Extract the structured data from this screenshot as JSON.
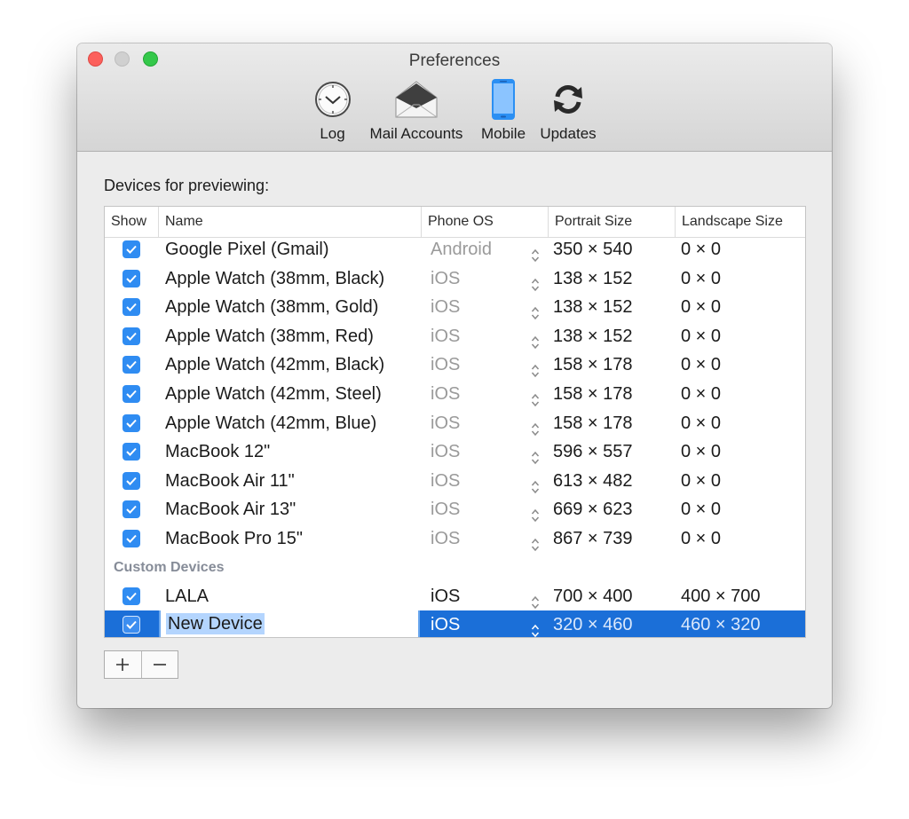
{
  "window": {
    "title": "Preferences"
  },
  "toolbar": [
    {
      "id": "log",
      "label": "Log",
      "icon": "clock-icon"
    },
    {
      "id": "mail",
      "label": "Mail Accounts",
      "icon": "envelope-icon"
    },
    {
      "id": "mobile",
      "label": "Mobile",
      "icon": "phone-icon",
      "selected": true
    },
    {
      "id": "updates",
      "label": "Updates",
      "icon": "refresh-icon"
    }
  ],
  "section_label": "Devices for previewing:",
  "columns": {
    "show": "Show",
    "name": "Name",
    "os": "Phone OS",
    "portrait": "Portrait Size",
    "landscape": "Landscape Size"
  },
  "devices": [
    {
      "checked": true,
      "name": "Google Pixel (Gmail)",
      "os": "Android",
      "portrait": "350 × 540",
      "landscape": "0 × 0"
    },
    {
      "checked": true,
      "name": "Apple Watch (38mm, Black)",
      "os": "iOS",
      "portrait": "138 × 152",
      "landscape": "0 × 0"
    },
    {
      "checked": true,
      "name": "Apple Watch (38mm, Gold)",
      "os": "iOS",
      "portrait": "138 × 152",
      "landscape": "0 × 0"
    },
    {
      "checked": true,
      "name": "Apple Watch (38mm, Red)",
      "os": "iOS",
      "portrait": "138 × 152",
      "landscape": "0 × 0"
    },
    {
      "checked": true,
      "name": "Apple Watch (42mm, Black)",
      "os": "iOS",
      "portrait": "158 × 178",
      "landscape": "0 × 0"
    },
    {
      "checked": true,
      "name": "Apple Watch (42mm, Steel)",
      "os": "iOS",
      "portrait": "158 × 178",
      "landscape": "0 × 0"
    },
    {
      "checked": true,
      "name": "Apple Watch (42mm, Blue)",
      "os": "iOS",
      "portrait": "158 × 178",
      "landscape": "0 × 0"
    },
    {
      "checked": true,
      "name": "MacBook 12\"",
      "os": "iOS",
      "portrait": "596 × 557",
      "landscape": "0 × 0"
    },
    {
      "checked": true,
      "name": "MacBook Air 11\"",
      "os": "iOS",
      "portrait": "613 × 482",
      "landscape": "0 × 0"
    },
    {
      "checked": true,
      "name": "MacBook Air 13\"",
      "os": "iOS",
      "portrait": "669 × 623",
      "landscape": "0 × 0"
    },
    {
      "checked": true,
      "name": "MacBook Pro 15\"",
      "os": "iOS",
      "portrait": "867 × 739",
      "landscape": "0 × 0"
    }
  ],
  "custom_group_label": "Custom Devices",
  "custom_devices": [
    {
      "checked": true,
      "name": "LALA",
      "os": "iOS",
      "portrait": "700 × 400",
      "landscape": "400 × 700"
    },
    {
      "checked": true,
      "name": "New Device",
      "os": "iOS",
      "portrait": "320 × 460",
      "landscape": "460 × 320",
      "selected": true,
      "editing": true
    }
  ],
  "buttons": {
    "add": "+",
    "remove": "−"
  },
  "colors": {
    "selection": "#1b6fd8",
    "checkbox": "#2f8cf2",
    "mobile_icon": "#2b8ff3",
    "group_header": "#868c98"
  }
}
